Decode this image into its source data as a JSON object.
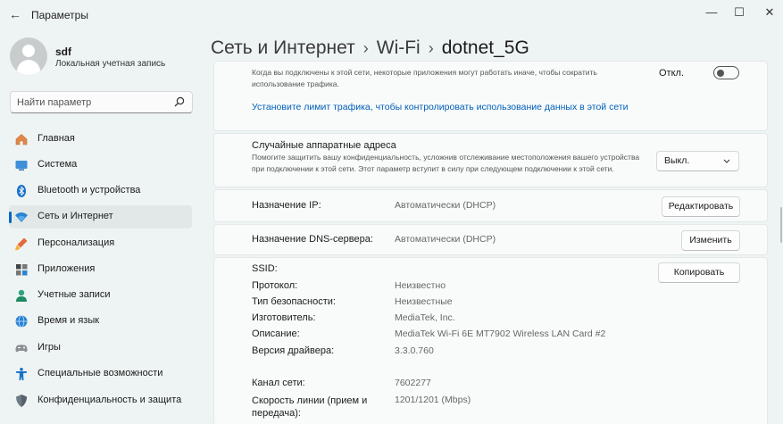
{
  "window": {
    "title": "Параметры",
    "back_icon": "arrow-left-icon",
    "controls": {
      "minimize": "—",
      "maximize": "☐",
      "close": "✕"
    }
  },
  "user": {
    "name": "sdf",
    "account_type": "Локальная учетная запись"
  },
  "search": {
    "placeholder": "Найти параметр",
    "value": ""
  },
  "sidebar": {
    "items": [
      {
        "label": "Главная",
        "icon": "home-icon"
      },
      {
        "label": "Система",
        "icon": "monitor-icon"
      },
      {
        "label": "Bluetooth и устройства",
        "icon": "bluetooth-icon"
      },
      {
        "label": "Сеть и Интернет",
        "icon": "wifi-icon",
        "active": true
      },
      {
        "label": "Персонализация",
        "icon": "brush-icon"
      },
      {
        "label": "Приложения",
        "icon": "apps-icon"
      },
      {
        "label": "Учетные записи",
        "icon": "person-icon"
      },
      {
        "label": "Время и язык",
        "icon": "globe-clock-icon"
      },
      {
        "label": "Игры",
        "icon": "gamepad-icon"
      },
      {
        "label": "Специальные возможности",
        "icon": "accessibility-icon"
      },
      {
        "label": "Конфиденциальность и защита",
        "icon": "shield-icon"
      }
    ]
  },
  "breadcrumb": {
    "items": [
      "Сеть и Интернет",
      "Wi-Fi",
      "dotnet_5G"
    ],
    "separator": "›"
  },
  "metered": {
    "description": "Когда вы подключены к этой сети, некоторые приложения могут работать иначе, чтобы сократить использование трафика.",
    "toggle_label": "Откл.",
    "toggle_on": false,
    "link": "Установите лимит трафика, чтобы контролировать использование данных в этой сети"
  },
  "random_mac": {
    "title": "Случайные аппаратные адреса",
    "description": "Помогите защитить вашу конфиденциальность, усложнив отслеживание местоположения вашего устройства при подключении к этой сети. Этот параметр вступит в силу при следующем подключении к этой сети.",
    "selected": "Выкл."
  },
  "ip": {
    "label": "Назначение IP:",
    "value": "Автоматически (DHCP)",
    "button": "Редактировать"
  },
  "dns": {
    "label": "Назначение DNS-сервера:",
    "value": "Автоматически (DHCP)",
    "button": "Изменить"
  },
  "properties": {
    "copy_button": "Копировать",
    "rows": [
      {
        "label": "SSID:",
        "value": ""
      },
      {
        "label": "Протокол:",
        "value": "Неизвестно"
      },
      {
        "label": "Тип безопасности:",
        "value": "Неизвестные"
      },
      {
        "label": "Изготовитель:",
        "value": "MediaTek, Inc."
      },
      {
        "label": "Описание:",
        "value": "MediaTek Wi-Fi 6E MT7902 Wireless LAN Card #2"
      },
      {
        "label": "Версия драйвера:",
        "value": "3.3.0.760"
      },
      {
        "label": "Канал сети:",
        "value": "7602277"
      },
      {
        "label": "Скорость линии (прием и передача):",
        "value": "1201/1201 (Mbps)"
      }
    ]
  },
  "colors": {
    "accent": "#0067c0",
    "link": "#005fb8",
    "background": "#eef4f3",
    "card": "#f9fbfb"
  }
}
